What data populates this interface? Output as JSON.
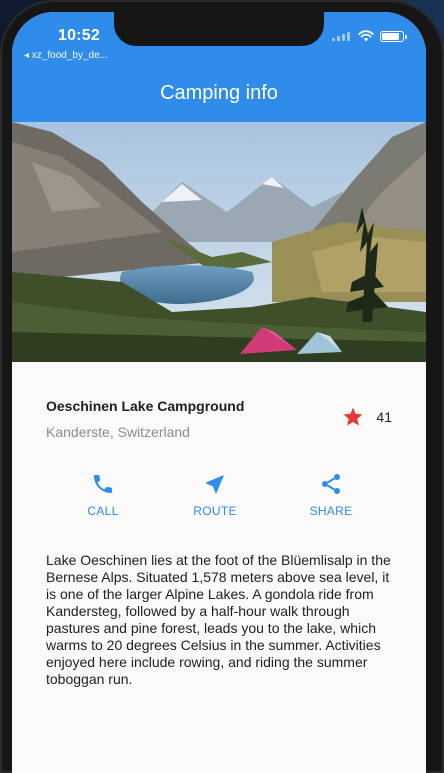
{
  "status_bar": {
    "time": "10:52",
    "back_app": "◂ xz_food_by_de..."
  },
  "app_bar": {
    "title": "Camping info",
    "color": "#2f8ceb"
  },
  "hero_image": {
    "description_icon": "landscape-photo"
  },
  "place": {
    "name": "Oeschinen Lake Campground",
    "location": "Kanderste, Switzerland",
    "rating_count": "41",
    "star_color": "#e53935"
  },
  "actions": [
    {
      "label": "CALL",
      "icon": "phone-icon"
    },
    {
      "label": "ROUTE",
      "icon": "navigation-icon"
    },
    {
      "label": "SHARE",
      "icon": "share-icon"
    }
  ],
  "description": "Lake Oeschinen lies at the foot of the Blüemlisalp in the Bernese Alps. Situated 1,578 meters above sea level, it is one of the larger Alpine Lakes. A gondola ride from Kandersteg, followed by a half-hour walk through pastures and pine forest, leads you to the lake, which warms to 20 degrees Celsius in the summer. Activities enjoyed here include rowing, and riding the summer toboggan run.",
  "accent_color": "#2f8ceb"
}
